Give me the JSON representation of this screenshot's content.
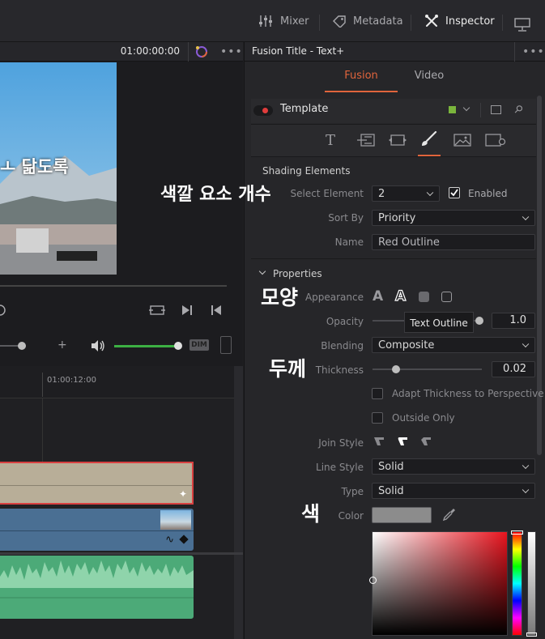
{
  "topbar": {
    "mixer_label": "Mixer",
    "metadata_label": "Metadata",
    "inspector_label": "Inspector"
  },
  "viewer": {
    "timecode": "01:00:00:00",
    "overlay_text": "닮도록",
    "overlay_prefix": "ㅗ",
    "dim_label": "DIM"
  },
  "timeline": {
    "ruler_time": "01:00:12:00"
  },
  "annotations": {
    "select_element_note": "색깔 요소 개수",
    "appearance_note": "모양",
    "thickness_note": "두께",
    "color_note": "색"
  },
  "inspector": {
    "title": "Fusion Title - Text+",
    "tabs": [
      "Fusion",
      "Video"
    ],
    "active_tab": "Fusion",
    "template_label": "Template",
    "section_shading": "Shading Elements",
    "select_element_label": "Select Element",
    "select_element_value": "2",
    "enabled_label": "Enabled",
    "sort_by_label": "Sort By",
    "sort_by_value": "Priority",
    "name_label": "Name",
    "name_value": "Red Outline",
    "properties_label": "Properties",
    "appearance_label": "Appearance",
    "tooltip": "Text Outline",
    "opacity_label": "Opacity",
    "opacity_value": "1.0",
    "blending_label": "Blending",
    "blending_value": "Composite",
    "thickness_label": "Thickness",
    "thickness_value": "0.02",
    "adapt_label": "Adapt Thickness to Perspective",
    "outside_only_label": "Outside Only",
    "join_style_label": "Join Style",
    "line_style_label": "Line Style",
    "line_style_value": "Solid",
    "type_label": "Type",
    "type_value": "Solid",
    "color_label": "Color"
  },
  "colors": {
    "accent_orange": "#e0643c",
    "track_video_title": "#b8ae98",
    "track_video": "#4a6f93",
    "track_audio": "#4caa78",
    "volume_green": "#3cb043"
  }
}
